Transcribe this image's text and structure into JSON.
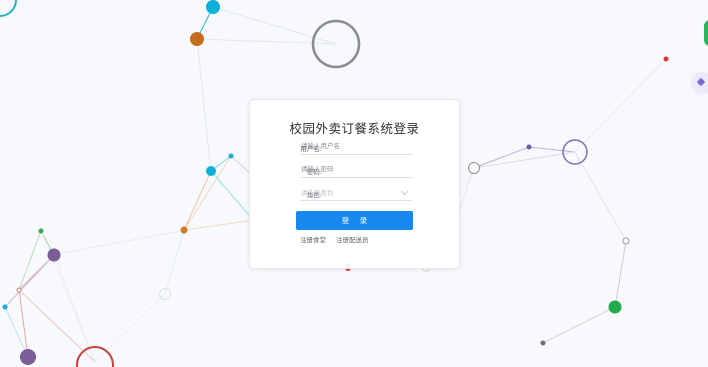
{
  "login": {
    "title": "校园外卖订餐系统登录",
    "username_label": "用户名:",
    "username_placeholder": "请输入用户名",
    "password_label": "密码:",
    "password_placeholder": "请输入密码",
    "role_label": "角色:",
    "role_placeholder": "请选择角色",
    "login_button": "登 录",
    "register_canteen": "注册食堂",
    "register_courier": "注册配送员"
  },
  "colors": {
    "accent": "#1789ee",
    "background": "#f7f9fc"
  }
}
